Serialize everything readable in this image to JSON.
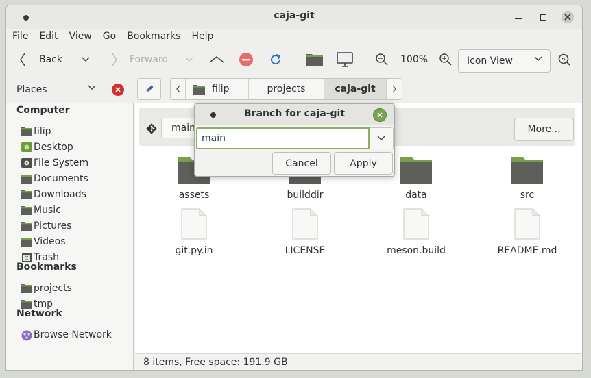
{
  "window": {
    "title": "caja-git"
  },
  "menubar": [
    "File",
    "Edit",
    "View",
    "Go",
    "Bookmarks",
    "Help"
  ],
  "toolbar": {
    "back_label": "Back",
    "forward_label": "Forward",
    "zoom_level": "100%",
    "view_mode": "Icon View"
  },
  "places": {
    "label": "Places"
  },
  "pathbar": [
    "filip",
    "projects",
    "caja-git"
  ],
  "sidebar": {
    "computer_heading": "Computer",
    "computer_items": [
      {
        "label": "filip",
        "icon": "folder-icon"
      },
      {
        "label": "Desktop",
        "icon": "desktop-icon"
      },
      {
        "label": "File System",
        "icon": "drive-icon"
      },
      {
        "label": "Documents",
        "icon": "folder-icon"
      },
      {
        "label": "Downloads",
        "icon": "folder-icon"
      },
      {
        "label": "Music",
        "icon": "folder-icon"
      },
      {
        "label": "Pictures",
        "icon": "folder-icon"
      },
      {
        "label": "Videos",
        "icon": "folder-icon"
      },
      {
        "label": "Trash",
        "icon": "trash-icon"
      }
    ],
    "bookmarks_heading": "Bookmarks",
    "bookmark_items": [
      {
        "label": "projects",
        "icon": "folder-icon"
      },
      {
        "label": "tmp",
        "icon": "folder-icon"
      }
    ],
    "network_heading": "Network",
    "network_items": [
      {
        "label": "Browse Network",
        "icon": "network-icon"
      }
    ]
  },
  "infobar": {
    "branch_value": "main",
    "more_label": "More..."
  },
  "files": [
    {
      "name": "assets",
      "type": "folder"
    },
    {
      "name": "builddir",
      "type": "folder"
    },
    {
      "name": "data",
      "type": "folder"
    },
    {
      "name": "src",
      "type": "folder"
    },
    {
      "name": "git.py.in",
      "type": "file"
    },
    {
      "name": "LICENSE",
      "type": "file"
    },
    {
      "name": "meson.build",
      "type": "file"
    },
    {
      "name": "README.md",
      "type": "file"
    }
  ],
  "status": {
    "text": "8 items, Free space: 191.9 GB"
  },
  "dialog": {
    "title": "Branch for caja-git",
    "entry_value": "main",
    "cancel_label": "Cancel",
    "apply_label": "Apply"
  },
  "colors": {
    "accent": "#7aa34f",
    "folder_dark": "#5c5f5a",
    "folder_tab": "#78a046",
    "close_red": "#d32f2f"
  }
}
